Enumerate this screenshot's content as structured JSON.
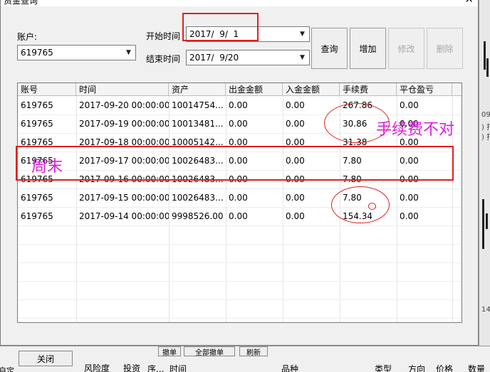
{
  "dialog": {
    "title": "资金查询",
    "close_glyph": "✕"
  },
  "form": {
    "account_label": "账户:",
    "account_value": "619765",
    "start_label": "开始时间",
    "start_value": "2017/  9/  1",
    "end_label": "结束时间",
    "end_value": "2017/  9/20"
  },
  "buttons": {
    "query": "查询",
    "add": "增加",
    "modify": "修改",
    "delete": "删除"
  },
  "table": {
    "columns": [
      "账号",
      "时间",
      "资产",
      "出金金额",
      "入金金额",
      "手续费",
      "平仓盈亏"
    ],
    "rows": [
      [
        "619765",
        "2017-09-20 00:00:00",
        "10014754...",
        "0.00",
        "0.00",
        "267.86",
        "0.00"
      ],
      [
        "619765",
        "2017-09-19 00:00:00",
        "10013481...",
        "0.00",
        "0.00",
        "30.86",
        "0.00"
      ],
      [
        "619765",
        "2017-09-18 00:00:00",
        "10005142...",
        "0.00",
        "0.00",
        "31.38",
        "0.00"
      ],
      [
        "619765",
        "2017-09-17 00:00:00",
        "10026483...",
        "0.00",
        "0.00",
        "7.80",
        "0.00"
      ],
      [
        "619765",
        "2017-09-16 00:00:00",
        "10026483...",
        "0.00",
        "0.00",
        "7.80",
        "0.00"
      ],
      [
        "619765",
        "2017-09-15 00:00:00",
        "10026483...",
        "0.00",
        "0.00",
        "7.80",
        "0.00"
      ],
      [
        "619765",
        "2017-09-14 00:00:00",
        "9998526.00",
        "0.00",
        "0.00",
        "154.34",
        "0.00"
      ]
    ]
  },
  "annotations": {
    "fee_wrong": "手续费不对",
    "weekend": "周末"
  },
  "bottom": {
    "close_button": "关闭",
    "left_text": "自定",
    "risk": "风险度",
    "invest": "投资",
    "tab_a": "撤单",
    "tab_b": "全部撤单",
    "tab_c": "刷新",
    "col_seq": "序...",
    "col_time": "时间",
    "col_product": "品种",
    "col_type": "类型",
    "col_dir": "方向",
    "col_price": "价格",
    "col_qty": "数量"
  },
  "background_right": {
    "text1": "09/",
    "text2": ") 打",
    "text3": ") 打",
    "text4": "14"
  },
  "colors": {
    "annotation_red": "#e02020",
    "annotation_magenta": "#d820d8"
  }
}
